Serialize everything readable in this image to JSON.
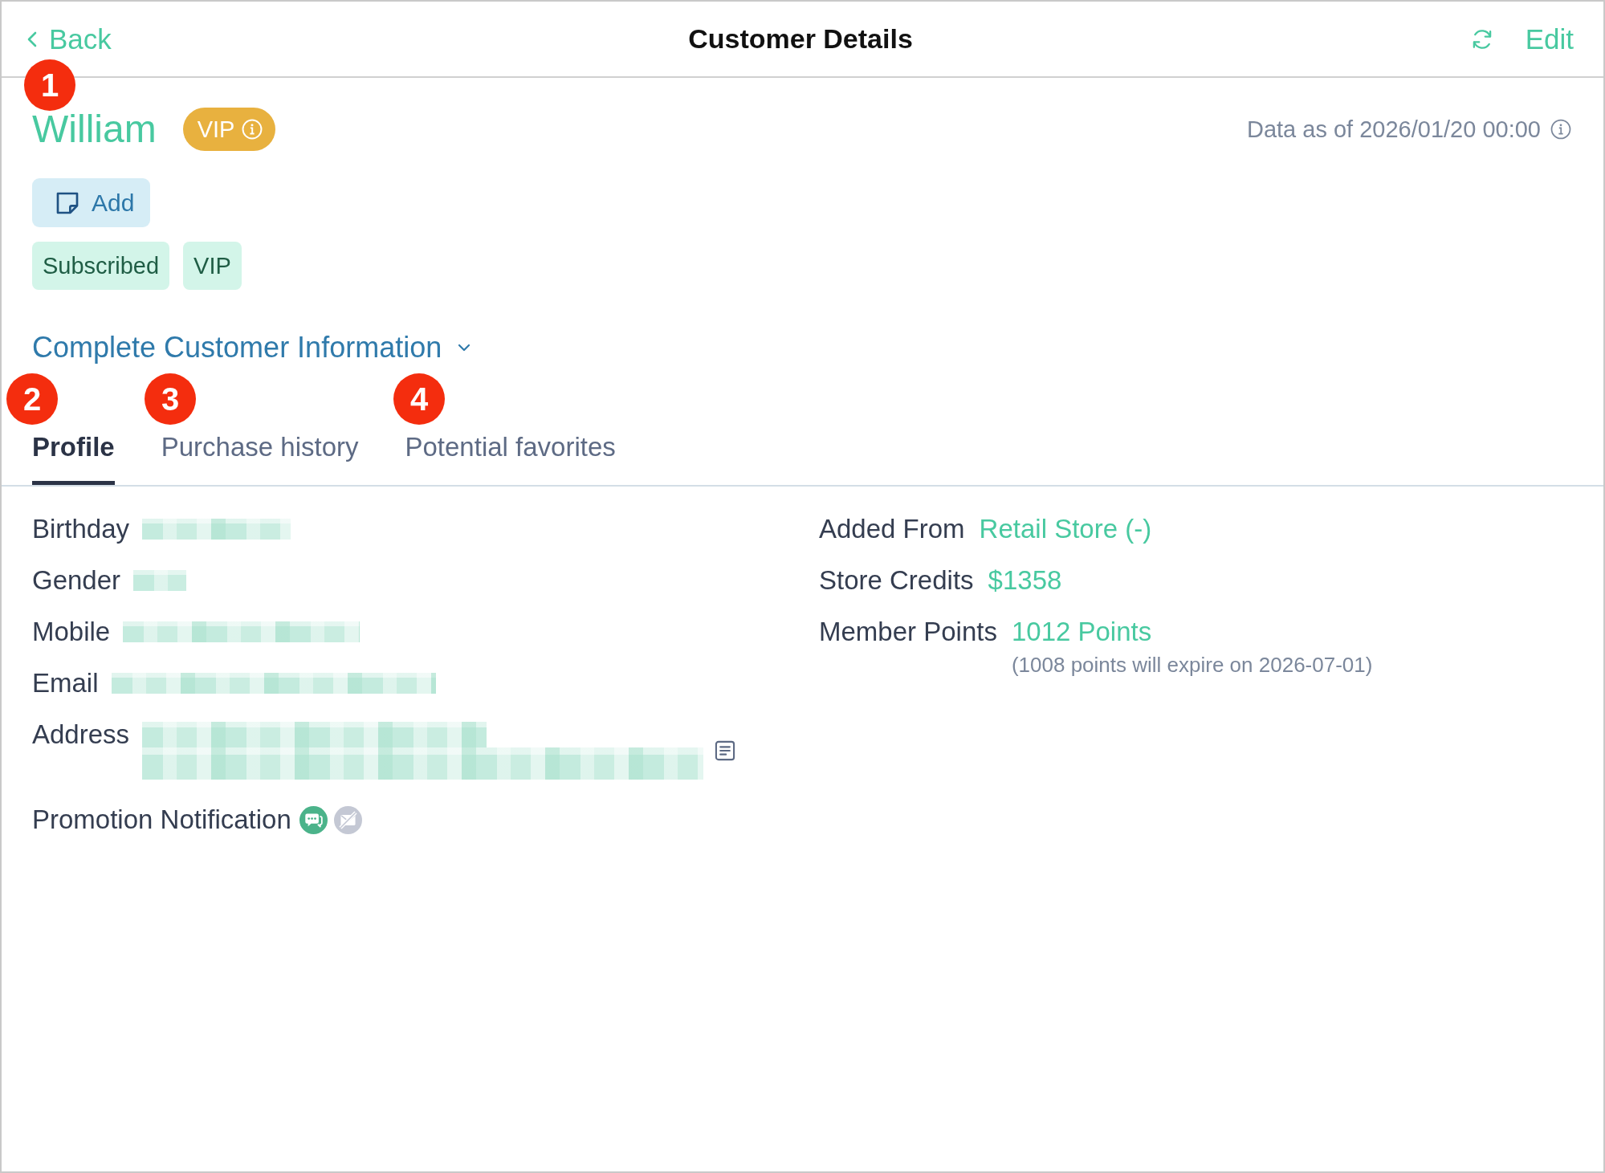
{
  "header": {
    "back": "Back",
    "title": "Customer Details",
    "edit": "Edit"
  },
  "customer": {
    "name": "William",
    "badge": "VIP",
    "data_as_of": "Data as of 2026/01/20 00:00"
  },
  "note_button": "Add",
  "tags": [
    {
      "label": "Subscribed"
    },
    {
      "label": "VIP"
    }
  ],
  "complete_info": {
    "label": "Complete Customer Information",
    "expanded": false
  },
  "tabs": [
    {
      "label": "Profile",
      "selected": true
    },
    {
      "label": "Purchase history",
      "selected": false
    },
    {
      "label": "Potential favorites",
      "selected": false
    }
  ],
  "profile": {
    "left": [
      {
        "kind": "redacted",
        "label": "Birthday"
      },
      {
        "kind": "redacted",
        "label": "Gender"
      },
      {
        "kind": "redacted",
        "label": "Mobile"
      },
      {
        "kind": "redacted",
        "label": "Email"
      },
      {
        "kind": "redacted_with_icon",
        "label": "Address"
      },
      {
        "kind": "channels",
        "label": "Promotion Notification",
        "channels": [
          {
            "kind": "sms",
            "on": true
          },
          {
            "kind": "email",
            "on": false
          }
        ]
      }
    ],
    "right": [
      {
        "label": "Added From",
        "value": "Retail Store (-)"
      },
      {
        "label": "Store Credits",
        "value": "$1358"
      },
      {
        "label": "Member Points",
        "value": "1012 Points",
        "note": "(1008 points will expire on 2026-07-01)"
      }
    ]
  },
  "annotations": [
    {
      "label": "1"
    },
    {
      "label": "2"
    },
    {
      "label": "3"
    },
    {
      "label": "4"
    }
  ]
}
